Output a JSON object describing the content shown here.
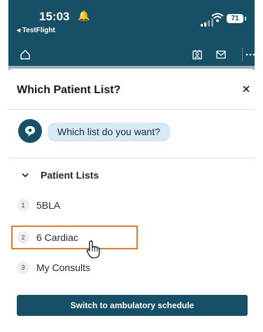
{
  "status_bar": {
    "time": "15:03",
    "bell_glyph": "🔔",
    "back_app": "◂ TestFlight",
    "battery": "71"
  },
  "toolbar": {
    "icons": [
      "home-icon",
      "patient-icon",
      "message-icon",
      "more-icon"
    ]
  },
  "sheet": {
    "title": "Which Patient List?",
    "close_icon": "close-icon"
  },
  "chat": {
    "avatar_icon": "chat-bot-icon",
    "prompt": "Which list do you want?"
  },
  "patient_lists": {
    "section_label": "Patient Lists",
    "items": [
      {
        "number": "1",
        "label": "5BLA"
      },
      {
        "number": "2",
        "label": "6 Cardiac"
      },
      {
        "number": "3",
        "label": "My Consults"
      }
    ]
  },
  "footer": {
    "switch_label": "Switch to ambulatory schedule"
  },
  "colors": {
    "brand": "#174f66",
    "bubble": "#d7e9f3",
    "highlight": "#e07a2c"
  }
}
